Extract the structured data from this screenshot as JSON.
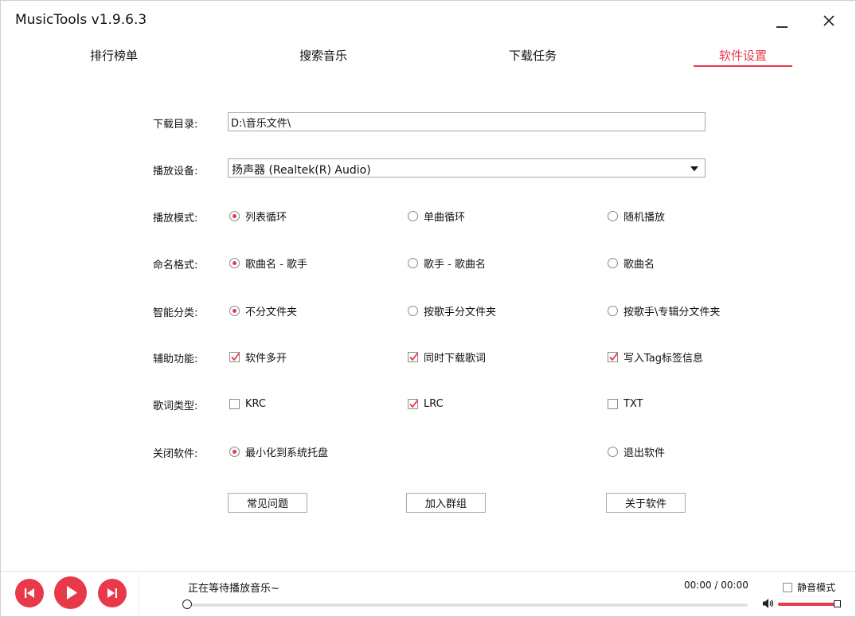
{
  "window": {
    "title": "MusicTools v1.9.6.3"
  },
  "tabs": [
    {
      "label": "排行榜单"
    },
    {
      "label": "搜索音乐"
    },
    {
      "label": "下载任务"
    },
    {
      "label": "软件设置",
      "active": true
    }
  ],
  "settings": {
    "download_dir": {
      "label": "下载目录:",
      "value": "D:\\音乐文件\\"
    },
    "play_device": {
      "label": "播放设备:",
      "value": "扬声器 (Realtek(R) Audio)"
    },
    "play_mode": {
      "label": "播放模式:",
      "options": [
        "列表循环",
        "单曲循环",
        "随机播放"
      ],
      "selected": "列表循环"
    },
    "naming_format": {
      "label": "命名格式:",
      "options": [
        "歌曲名 - 歌手",
        "歌手 - 歌曲名",
        "歌曲名"
      ],
      "selected": "歌曲名 - 歌手"
    },
    "smart_sort": {
      "label": "智能分类:",
      "options": [
        "不分文件夹",
        "按歌手分文件夹",
        "按歌手\\专辑分文件夹"
      ],
      "selected": "不分文件夹"
    },
    "assist": {
      "label": "辅助功能:",
      "options": [
        {
          "label": "软件多开",
          "checked": true
        },
        {
          "label": "同时下载歌词",
          "checked": true
        },
        {
          "label": "写入Tag标签信息",
          "checked": true
        }
      ]
    },
    "lyric_type": {
      "label": "歌词类型:",
      "options": [
        {
          "label": "KRC",
          "checked": false
        },
        {
          "label": "LRC",
          "checked": true
        },
        {
          "label": "TXT",
          "checked": false
        }
      ]
    },
    "close_action": {
      "label": "关闭软件:",
      "options": [
        "最小化到系统托盘",
        "退出软件"
      ],
      "selected": "最小化到系统托盘"
    },
    "buttons": [
      "常见问题",
      "加入群组",
      "关于软件"
    ]
  },
  "player": {
    "status": "正在等待播放音乐~",
    "time": "00:00 / 00:00",
    "progress": 0,
    "mute_label": "静音模式",
    "mute_checked": false,
    "volume": 1.0
  },
  "colors": {
    "accent": "#e8394a",
    "border": "#a9a9a9",
    "text": "#111111"
  },
  "icons": [
    "minimize-icon",
    "close-icon",
    "dropdown-arrow-icon",
    "checkmark-icon",
    "previous-icon",
    "play-icon",
    "next-icon",
    "speaker-icon"
  ]
}
